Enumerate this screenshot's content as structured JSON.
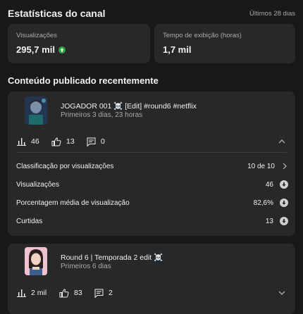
{
  "header": {
    "title": "Estatísticas do canal",
    "period": "Últimos 28 dias"
  },
  "stats": [
    {
      "label": "Visualizações",
      "value": "295,7 mil"
    },
    {
      "label": "Tempo de exibição (horas)",
      "value": "1,7 mil"
    }
  ],
  "section_title": "Conteúdo publicado recentemente",
  "videos": [
    {
      "title": "JOGADOR 001 ☠️ [Edit] #round6 #netflix",
      "subtitle": "Primeiros 3 dias, 23 horas",
      "views": "46",
      "likes": "13",
      "comments": "0",
      "details": [
        {
          "label": "Classificação por visualizações",
          "value": "10 de 10"
        },
        {
          "label": "Visualizações",
          "value": "46"
        },
        {
          "label": "Porcentagem média de visualização",
          "value": "82,6%"
        },
        {
          "label": "Curtidas",
          "value": "13"
        }
      ]
    },
    {
      "title": "Round 6 | Temporada 2 edit ☠️",
      "subtitle": "Primeiros 6 dias",
      "views": "2 mil",
      "likes": "83",
      "comments": "2"
    }
  ],
  "colors": {
    "background": "#181818",
    "card": "#282828",
    "trend_up": "#2ba640",
    "secondary_text": "#aaaaaa"
  }
}
